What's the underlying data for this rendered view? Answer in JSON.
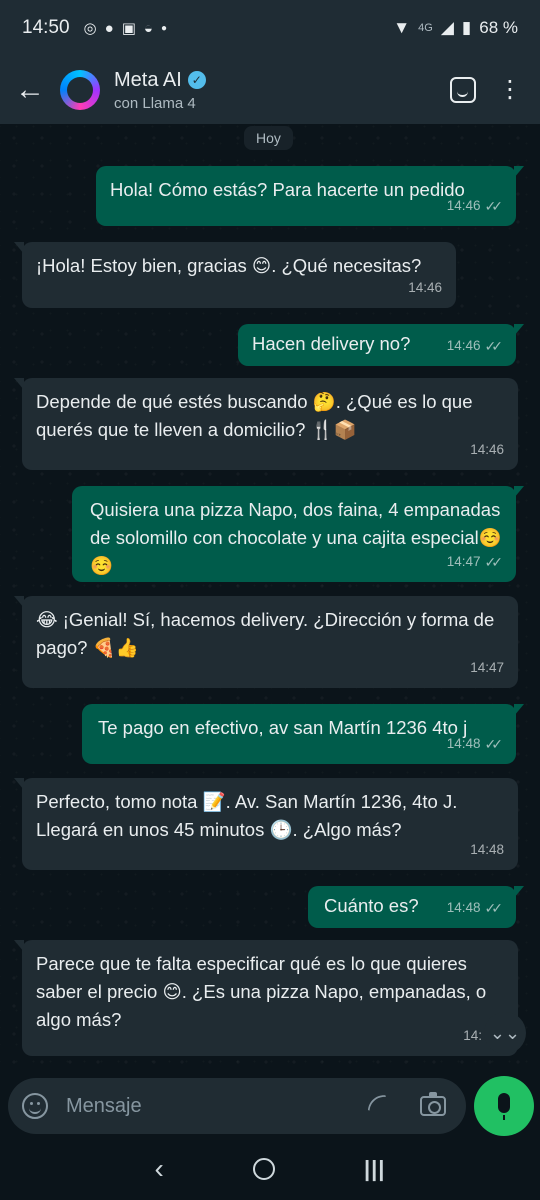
{
  "status_bar": {
    "time": "14:50",
    "icons": [
      "whatsapp-icon",
      "chat-icon",
      "instagram-icon",
      "mask-icon",
      "dot-icon"
    ],
    "network": "4G",
    "battery": "68 %"
  },
  "header": {
    "name": "Meta AI",
    "subtitle": "con Llama 4"
  },
  "chat": {
    "day_label": "Hoy",
    "messages": [
      {
        "dir": "out",
        "text": "Hola! Cómo estás? Para hacerte un pedido",
        "time": "14:46",
        "ticks": "✓✓"
      },
      {
        "dir": "in",
        "text": "¡Hola! Estoy bien, gracias 😊. ¿Qué necesitas?",
        "time": "14:46"
      },
      {
        "dir": "out",
        "text": "Hacen delivery no?",
        "time": "14:46",
        "ticks": "✓✓"
      },
      {
        "dir": "in",
        "text": "Depende de qué estés buscando 🤔. ¿Qué es lo que querés que te lleven a domicilio? 🍴📦",
        "time": "14:46"
      },
      {
        "dir": "out",
        "text": "Quisiera una pizza Napo, dos faina, 4 empanadas de solomillo con chocolate y una cajita especial☺️☺️",
        "time": "14:47",
        "ticks": "✓✓"
      },
      {
        "dir": "in",
        "text": "😂 ¡Genial! Sí, hacemos delivery. ¿Dirección y forma de pago? 🍕👍",
        "time": "14:47"
      },
      {
        "dir": "out",
        "text": "Te pago en efectivo, av san Martín 1236 4to j",
        "time": "14:48",
        "ticks": "✓✓"
      },
      {
        "dir": "in",
        "text": "Perfecto, tomo nota 📝. Av. San Martín 1236, 4to J. Llegará en unos 45 minutos 🕒. ¿Algo más?",
        "time": "14:48"
      },
      {
        "dir": "out",
        "text": "Cuánto es?",
        "time": "14:48",
        "ticks": "✓✓"
      },
      {
        "dir": "in",
        "text": "Parece que te falta especificar qué es lo que quieres saber el precio 😊. ¿Es una pizza Napo, empanadas, o algo más?",
        "time": "14:"
      }
    ]
  },
  "composer": {
    "placeholder": "Mensaje"
  },
  "colors": {
    "outgoing_bubble": "#005c4b",
    "incoming_bubble": "#202c33",
    "accent": "#21c063",
    "background": "#0b141a"
  }
}
